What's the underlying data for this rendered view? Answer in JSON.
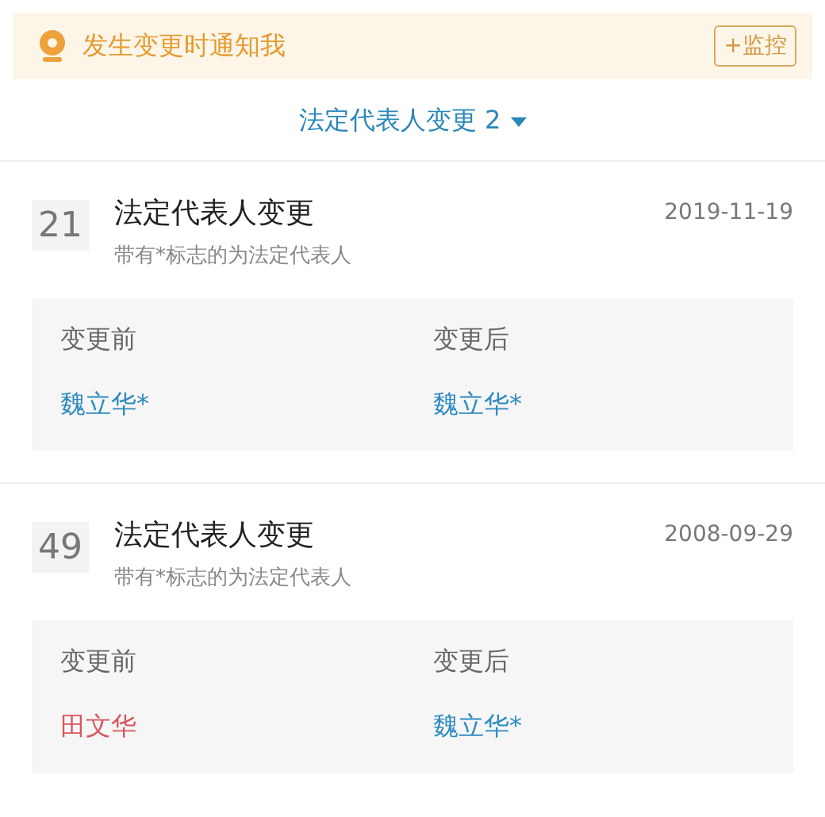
{
  "notice": {
    "text": "发生变更时通知我",
    "button": "+监控"
  },
  "filter": {
    "label": "法定代表人变更 2"
  },
  "records": [
    {
      "number": "21",
      "title": "法定代表人变更",
      "date": "2019-11-19",
      "note": "带有*标志的为法定代表人",
      "before_label": "变更前",
      "after_label": "变更后",
      "before": {
        "name": "魏立华*",
        "color": "#2e8bc0"
      },
      "after": {
        "name": "魏立华*",
        "color": "#2e8bc0"
      }
    },
    {
      "number": "49",
      "title": "法定代表人变更",
      "date": "2008-09-29",
      "note": "带有*标志的为法定代表人",
      "before_label": "变更前",
      "after_label": "变更后",
      "before": {
        "name": "田文华",
        "color": "#d9545e"
      },
      "after": {
        "name": "魏立华*",
        "color": "#2e8bc0"
      }
    }
  ]
}
